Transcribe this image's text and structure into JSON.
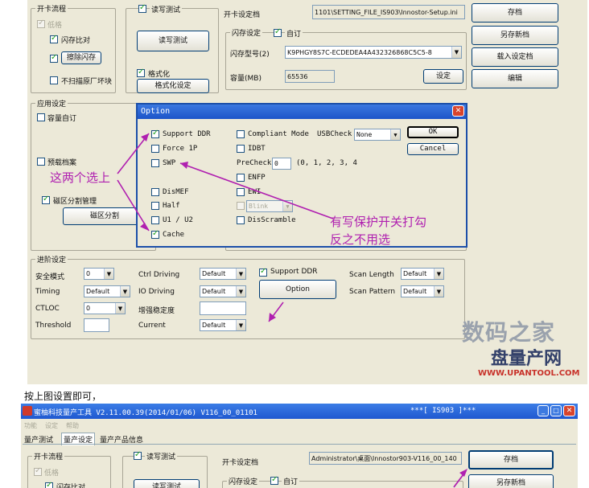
{
  "top": {
    "card_flow": {
      "group_label": "开卡流程",
      "items": [
        {
          "label": "低格",
          "checked": true,
          "disabled": true
        },
        {
          "label": "闪存比对",
          "checked": true
        },
        {
          "label": "擦除闪存",
          "checked": true
        },
        {
          "label": "不扫描原厂坏块",
          "checked": false
        }
      ]
    },
    "rw_test": {
      "checkbox_label": "读写测试",
      "checked": true,
      "button_label": "读写测试"
    },
    "format": {
      "checkbox_label": "格式化",
      "checked": true,
      "button_label": "格式化设定"
    },
    "settings_file": {
      "label": "开卡设定档",
      "value": "1101\\SETTING_FILE_IS903\\Innostor-Setup.ini"
    },
    "flash_group": {
      "group_label": "闪存设定",
      "custom_label": "自订",
      "custom_checked": true,
      "flash_id_label": "闪存型号(2)",
      "flash_id_value": "K9PHGY8S7C-ECDEDEA4A432326868C5C5-8",
      "capacity_label": "容量(MB)",
      "capacity_value": "65536",
      "set_button": "设定"
    },
    "right_buttons": [
      "存档",
      "另存新档",
      "载入设定档",
      "编辑"
    ],
    "app_group": {
      "group_label": "应用设定",
      "capacity_custom": "容量自订",
      "preload": "预载档案",
      "partition_checkbox": "磁区分割管理",
      "partition_button": "磁区分割"
    },
    "advanced": {
      "group_label": "进阶设定",
      "rows_left": [
        {
          "label": "安全模式",
          "value": "0"
        },
        {
          "label": "Timing",
          "value": "Default"
        },
        {
          "label": "CTLOC",
          "value": "0"
        },
        {
          "label": "Threshold",
          "value": ""
        }
      ],
      "rows_mid": [
        {
          "label": "Ctrl Driving",
          "value": "Default"
        },
        {
          "label": "IO Driving",
          "value": "Default"
        },
        {
          "label": "增强稳定度",
          "value": ""
        },
        {
          "label": "Current",
          "value": "Default"
        }
      ],
      "support_ddr": "Support DDR",
      "support_ddr_checked": true,
      "option_button": "Option",
      "rows_right": [
        {
          "label": "Scan Length",
          "value": "Default"
        },
        {
          "label": "Scan Pattern",
          "value": "Default"
        }
      ]
    },
    "dialog": {
      "title": "Option",
      "col1": [
        {
          "label": "Support DDR",
          "checked": true
        },
        {
          "label": "Force 1P",
          "checked": false
        },
        {
          "label": "SWP",
          "checked": false
        },
        {
          "label": "DisMEF",
          "checked": false
        },
        {
          "label": "Half",
          "checked": false
        },
        {
          "label": "U1 / U2",
          "checked": false
        },
        {
          "label": "Cache",
          "checked": true
        }
      ],
      "compliant_mode": "Compliant Mode",
      "usbcheck_label": "USBCheck",
      "usbcheck_value": "None",
      "idbt": "IDBT",
      "precheck_label": "PreCheck",
      "precheck_value": "0",
      "precheck_hint": "(0, 1, 2, 3, 4",
      "enfp": "ENFP",
      "ewi": "EWI",
      "blink_value": "Blink",
      "discramble": "DisScramble",
      "ok": "OK",
      "cancel": "Cancel"
    },
    "annotation1": "这两个选上",
    "annotation2_line1": "有写保护开关打勾",
    "annotation2_line2": "反之不用选",
    "watermark_cn": "数码之家",
    "watermark_logo": "盘量产网",
    "watermark_url": "WWW.UPANTOOL.COM"
  },
  "caption": "按上图设置即可，",
  "bottom": {
    "title": "蜜柚科技量产工具 V2.11.00.39(2014/01/06)     V116_00_01101",
    "title_right": "***[ IS903 ]***",
    "menu": [
      "功能",
      "设定",
      "帮助"
    ],
    "tabs": [
      "量产测试",
      "量产设定",
      "量产产品信息"
    ],
    "card_flow_label": "开卡流程",
    "low_format": "低格",
    "flash_compare": "闪存比对",
    "rw_test_checkbox": "读写测试",
    "rw_test_button": "读写测试",
    "settings_file_label": "开卡设定档",
    "settings_file_value": "Administrator\\桌面\\Innostor903-V116_00_140",
    "flash_group": "闪存设定",
    "custom": "自订",
    "save": "存档",
    "save_as": "另存新档"
  },
  "colors": {
    "annotation": "#b020b0",
    "window_bg": "#ece9d8",
    "xp_blue": "#1c54c9"
  }
}
